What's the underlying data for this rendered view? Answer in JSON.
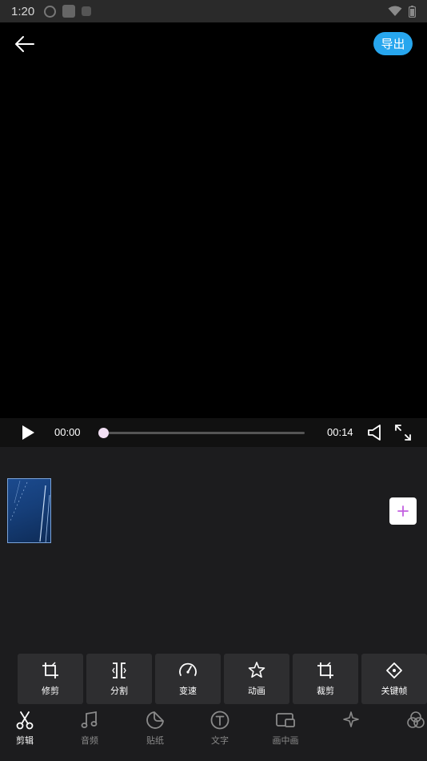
{
  "status_bar": {
    "time": "1:20"
  },
  "header": {
    "export_label": "导出"
  },
  "player": {
    "current_time": "00:00",
    "total_time": "00:14",
    "progress": 0.0
  },
  "tools": [
    {
      "label": "修剪",
      "icon": "crop-icon"
    },
    {
      "label": "分割",
      "icon": "split-icon"
    },
    {
      "label": "变速",
      "icon": "speedometer-icon"
    },
    {
      "label": "动画",
      "icon": "star-icon"
    },
    {
      "label": "裁剪",
      "icon": "crop-icon"
    },
    {
      "label": "关键帧",
      "icon": "keyframe-diamond-icon"
    }
  ],
  "nav": [
    {
      "label": "剪辑",
      "icon": "scissors-icon",
      "active": true
    },
    {
      "label": "音频",
      "icon": "music-note-icon",
      "active": false
    },
    {
      "label": "贴纸",
      "icon": "sticker-icon",
      "active": false
    },
    {
      "label": "文字",
      "icon": "text-icon",
      "active": false
    },
    {
      "label": "画中画",
      "icon": "picture-in-picture-icon",
      "active": false
    },
    {
      "label": "",
      "icon": "effects-icon",
      "active": false
    },
    {
      "label": "",
      "icon": "filter-icon",
      "active": false
    }
  ],
  "colors": {
    "accent": "#27a6ee",
    "progress_thumb": "#f1dff3",
    "add_plus": "#c25fe0"
  }
}
